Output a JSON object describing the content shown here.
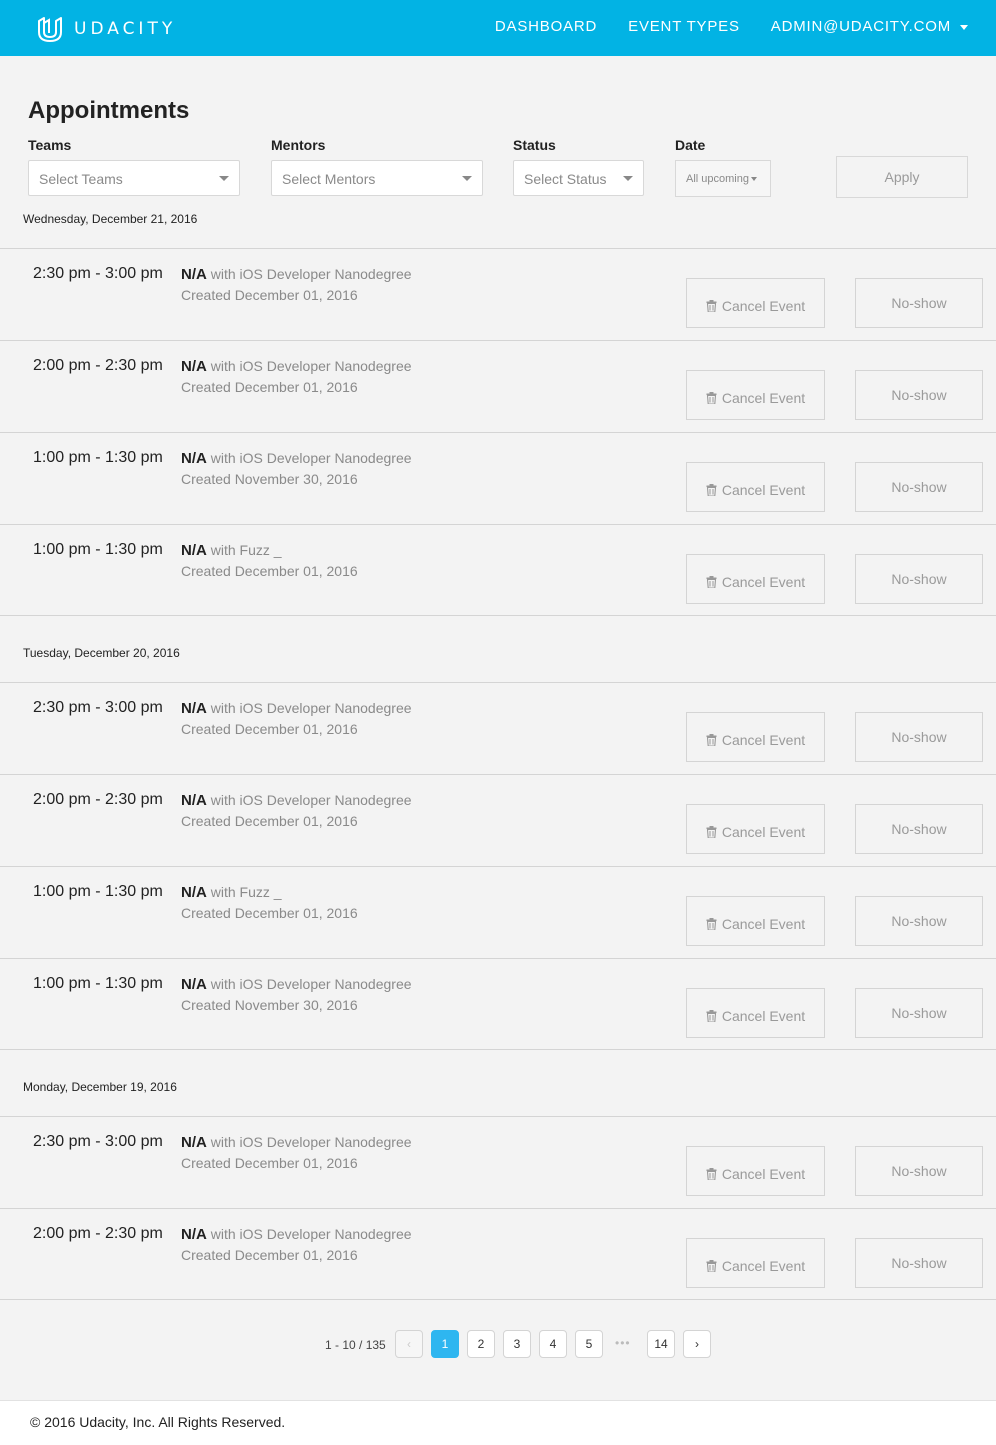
{
  "header": {
    "brand": "UDACITY",
    "nav": {
      "dashboard": "DASHBOARD",
      "event_types": "EVENT TYPES",
      "account": "ADMIN@UDACITY.COM"
    }
  },
  "page": {
    "title": "Appointments"
  },
  "filters": {
    "teams": {
      "label": "Teams",
      "placeholder": "Select Teams"
    },
    "mentors": {
      "label": "Mentors",
      "placeholder": "Select Mentors"
    },
    "status": {
      "label": "Status",
      "placeholder": "Select Status"
    },
    "date": {
      "label": "Date",
      "value": "All upcoming"
    },
    "apply_label": "Apply"
  },
  "groups": [
    {
      "date": "Wednesday, December 21, 2016",
      "items": [
        {
          "time": "2:30 pm - 3:00 pm",
          "name": "N/A",
          "with": "with iOS Developer Nanodegree",
          "created": "Created December 01, 2016"
        },
        {
          "time": "2:00 pm - 2:30 pm",
          "name": "N/A",
          "with": "with iOS Developer Nanodegree",
          "created": "Created December 01, 2016"
        },
        {
          "time": "1:00 pm - 1:30 pm",
          "name": "N/A",
          "with": "with iOS Developer Nanodegree",
          "created": "Created November 30, 2016"
        },
        {
          "time": "1:00 pm - 1:30 pm",
          "name": "N/A",
          "with": "with Fuzz _",
          "created": "Created December 01, 2016"
        }
      ]
    },
    {
      "date": "Tuesday, December 20, 2016",
      "items": [
        {
          "time": "2:30 pm - 3:00 pm",
          "name": "N/A",
          "with": "with iOS Developer Nanodegree",
          "created": "Created December 01, 2016"
        },
        {
          "time": "2:00 pm - 2:30 pm",
          "name": "N/A",
          "with": "with iOS Developer Nanodegree",
          "created": "Created December 01, 2016"
        },
        {
          "time": "1:00 pm - 1:30 pm",
          "name": "N/A",
          "with": "with Fuzz _",
          "created": "Created December 01, 2016"
        },
        {
          "time": "1:00 pm - 1:30 pm",
          "name": "N/A",
          "with": "with iOS Developer Nanodegree",
          "created": "Created November 30, 2016"
        }
      ]
    },
    {
      "date": "Monday, December 19, 2016",
      "items": [
        {
          "time": "2:30 pm - 3:00 pm",
          "name": "N/A",
          "with": "with iOS Developer Nanodegree",
          "created": "Created December 01, 2016"
        },
        {
          "time": "2:00 pm - 2:30 pm",
          "name": "N/A",
          "with": "with iOS Developer Nanodegree",
          "created": "Created December 01, 2016"
        }
      ]
    }
  ],
  "actions": {
    "cancel_label": "Cancel Event",
    "noshow_label": "No-show"
  },
  "pagination": {
    "summary": "1 - 10 / 135",
    "prev": "‹",
    "next": "›",
    "pages": [
      "1",
      "2",
      "3",
      "4",
      "5"
    ],
    "ellipsis": "•••",
    "last": "14",
    "current": "1"
  },
  "footer": {
    "copyright": "© 2016 Udacity, Inc. All Rights Reserved."
  },
  "colors": {
    "brand": "#02b3e4",
    "page_active": "#2eb6f0"
  }
}
